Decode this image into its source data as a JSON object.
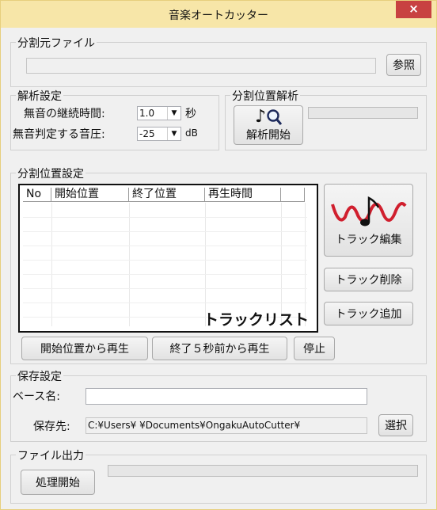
{
  "window": {
    "title": "音楽オートカッター",
    "close_glyph": "×"
  },
  "source_file": {
    "legend": "分割元ファイル",
    "path_value": "",
    "browse_label": "参照"
  },
  "analysis": {
    "legend": "解析設定",
    "silence_duration_label": "無音の継続時間:",
    "silence_duration_value": "1.0",
    "silence_duration_unit": "秒",
    "silence_level_label": "無音判定する音圧:",
    "silence_level_value": "-25",
    "silence_level_unit": "dB"
  },
  "split_analysis": {
    "legend": "分割位置解析",
    "start_label": "解析開始",
    "music_note": "♪"
  },
  "split_settings": {
    "legend": "分割位置設定",
    "columns": [
      "No",
      "開始位置",
      "終了位置",
      "再生時間"
    ],
    "overlay_text": "トラックリスト",
    "edit_label": "トラック編集",
    "delete_label": "トラック削除",
    "add_label": "トラック追加",
    "play_from_start_label": "開始位置から再生",
    "play_before_end_label": "終了５秒前から再生",
    "stop_label": "停止"
  },
  "save": {
    "legend": "保存設定",
    "base_name_label": "ベース名:",
    "base_name_value": "",
    "dest_label": "保存先:",
    "dest_value": "C:¥Users¥             ¥Documents¥OngakuAutoCutter¥",
    "select_label": "選択"
  },
  "output": {
    "legend": "ファイル出力",
    "start_label": "処理開始",
    "progress_fraction": 0
  },
  "colors": {
    "titlebar": "#f7e6a8",
    "close": "#c84141",
    "wave_icon": "#d01f2e"
  }
}
